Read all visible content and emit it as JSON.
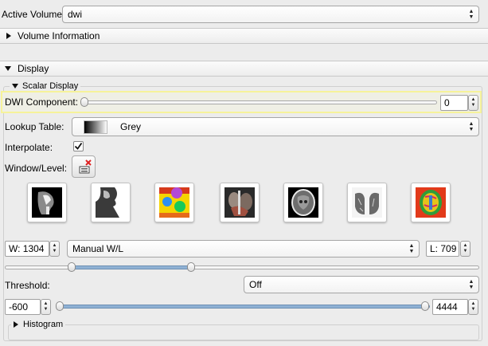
{
  "active_volume": {
    "label": "Active Volume",
    "value": "dwi"
  },
  "sections": {
    "volume_information": "Volume Information",
    "display": "Display",
    "scalar_display": "Scalar Display",
    "histogram": "Histogram"
  },
  "dwi_component": {
    "label": "DWI Component:",
    "value": "0",
    "slider_fraction": 0.0
  },
  "lookup_table": {
    "label": "Lookup Table:",
    "value": "Grey"
  },
  "interpolate": {
    "label": "Interpolate:",
    "checked": true
  },
  "window_level": {
    "label": "Window/Level:",
    "presets": [
      {
        "name": "CT-Bone",
        "icon": "ct-bone-preset-icon"
      },
      {
        "name": "CT-Air",
        "icon": "ct-air-preset-icon"
      },
      {
        "name": "PET",
        "icon": "pet-preset-icon"
      },
      {
        "name": "CT-Abdomen",
        "icon": "ct-abdomen-preset-icon"
      },
      {
        "name": "CT-Brain",
        "icon": "ct-brain-preset-icon"
      },
      {
        "name": "CT-Lung",
        "icon": "ct-lung-preset-icon"
      },
      {
        "name": "DTI",
        "icon": "dti-preset-icon"
      }
    ],
    "window": "W: 1304",
    "mode": "Manual W/L",
    "level": "L: 709"
  },
  "threshold": {
    "label": "Threshold:",
    "mode": "Off",
    "min": "-600",
    "max": "4444"
  }
}
